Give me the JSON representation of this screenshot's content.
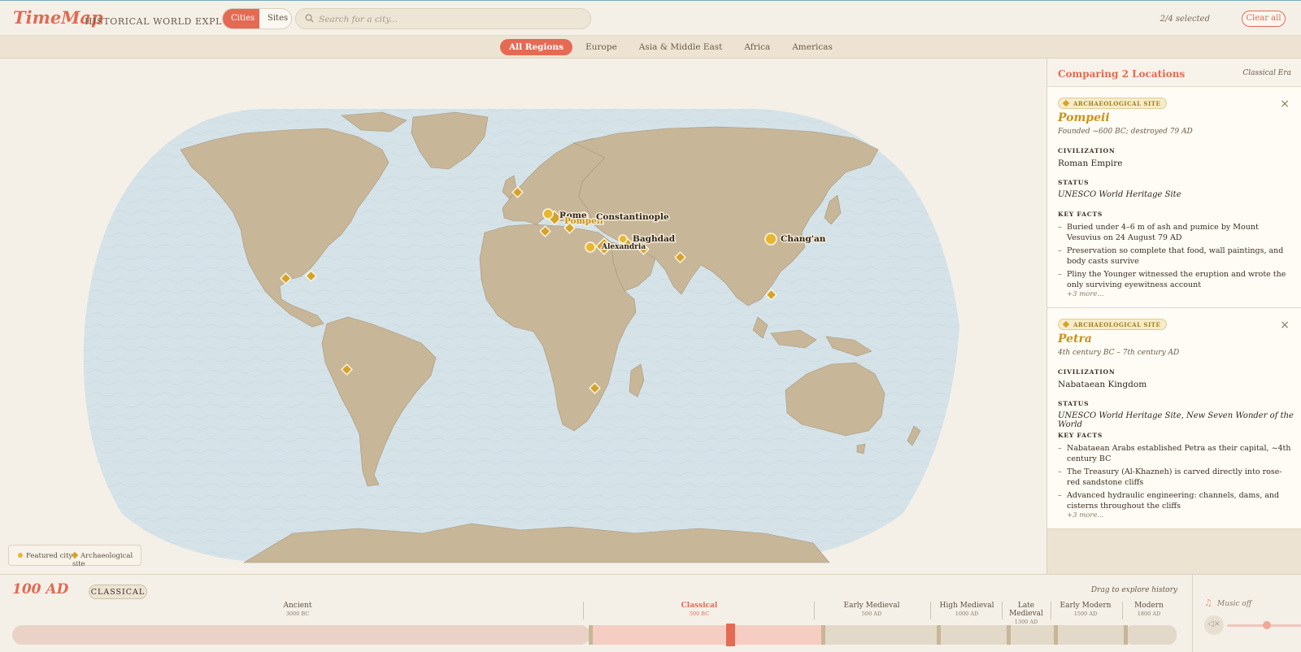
{
  "header": {
    "logo": "TimeMap",
    "subtitle": "HISTORICAL WORLD EXPLORER",
    "mode_cities": "Cities",
    "mode_sites": "Sites",
    "search_placeholder": "Search for a city...",
    "selected_count": "2/4 selected",
    "clear_label": "Clear all"
  },
  "regions": {
    "tabs": [
      "All Regions",
      "Europe",
      "Asia & Middle East",
      "Africa",
      "Americas"
    ],
    "active": "All Regions"
  },
  "map": {
    "legend_city": "Featured city",
    "legend_site": "Archaeological site",
    "city_labels": [
      "Rome",
      "Pompeii",
      "Constantinople",
      "Alexandria",
      "Baghdad",
      "Chang'an"
    ]
  },
  "panel": {
    "title": "Comparing 2 Locations",
    "era": "Classical Era",
    "cards": [
      {
        "badge": "ARCHAEOLOGICAL SITE",
        "name": "Pompeii",
        "founded": "Founded ~600 BC; destroyed 79 AD",
        "civ_label": "CIVILIZATION",
        "civ": "Roman Empire",
        "status_label": "STATUS",
        "status": "UNESCO World Heritage Site",
        "facts_label": "KEY FACTS",
        "facts": [
          "Buried under 4–6 m of ash and pumice by Mount Vesuvius on 24 August 79 AD",
          "Preservation so complete that food, wall paintings, and body casts survive",
          "Pliny the Younger witnessed the eruption and wrote the only surviving eyewitness account"
        ],
        "more": "+3 more..."
      },
      {
        "badge": "ARCHAEOLOGICAL SITE",
        "name": "Petra",
        "founded": "4th century BC – 7th century AD",
        "civ_label": "CIVILIZATION",
        "civ": "Nabataean Kingdom",
        "status_label": "STATUS",
        "status": "UNESCO World Heritage Site, New Seven Wonder of the World",
        "facts_label": "KEY FACTS",
        "facts": [
          "Nabataean Arabs established Petra as their capital, ~4th century BC",
          "The Treasury (Al-Khazneh) is carved directly into rose-red sandstone cliffs",
          "Advanced hydraulic engineering: channels, dams, and cisterns throughout the cliffs"
        ],
        "more": "+3 more..."
      }
    ]
  },
  "timeline": {
    "year": "100 AD",
    "era_badge": "CLASSICAL",
    "hint": "Drag to explore history",
    "eras": [
      {
        "name": "Ancient",
        "start": "3000 BC"
      },
      {
        "name": "Classical",
        "start": "500 BC"
      },
      {
        "name": "Early Medieval",
        "start": "500 AD"
      },
      {
        "name": "High Medieval",
        "start": "1000 AD"
      },
      {
        "name": "Late Medieval",
        "start": "1300 AD"
      },
      {
        "name": "Early Modern",
        "start": "1500 AD"
      },
      {
        "name": "Modern",
        "start": "1800 AD"
      }
    ],
    "current_era": "Classical"
  },
  "music": {
    "label": "Music off",
    "volume": 0.6
  },
  "colors": {
    "accent": "#e46a54",
    "gold": "#e8b730",
    "ocean": "#d5e3e8",
    "land": "#c8b699"
  }
}
